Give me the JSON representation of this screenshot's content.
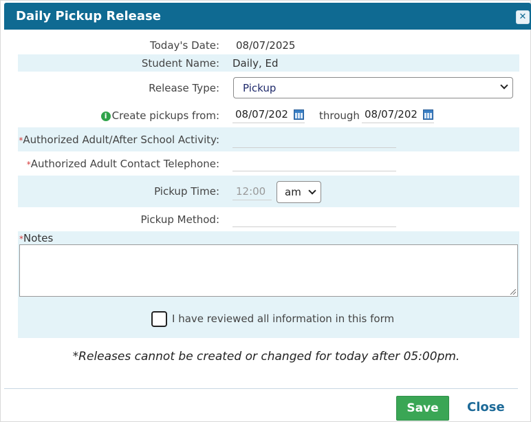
{
  "dialog": {
    "title": "Daily Pickup Release",
    "close_icon": "close-icon"
  },
  "form": {
    "todays_date_label": "Today's Date:",
    "todays_date_value": "08/07/2025",
    "student_name_label": "Student Name:",
    "student_name_value": "Daily, Ed",
    "release_type_label": "Release Type:",
    "release_type_value": "Pickup",
    "create_pickups_label": "Create pickups from:",
    "from_date": "08/07/202",
    "through_label": "through",
    "through_date": "08/07/202",
    "authorized_adult_label": "Authorized Adult/After School Activity:",
    "authorized_adult_value": "",
    "contact_phone_label": "Authorized Adult Contact Telephone:",
    "contact_phone_value": "",
    "pickup_time_label": "Pickup Time:",
    "pickup_time_placeholder": "12:00",
    "ampm_value": "am",
    "pickup_method_label": "Pickup Method:",
    "pickup_method_value": "",
    "required_marker": "*",
    "notes_label": "Notes",
    "notes_value": "",
    "review_checkbox_label": "I have reviewed all information in this form",
    "review_checked": false,
    "footnote": "*Releases cannot be created or changed for today after 05:00pm."
  },
  "buttons": {
    "save_label": "Save",
    "close_label": "Close"
  },
  "colors": {
    "header_bg": "#0f6a92",
    "band_bg": "#e4f3f8",
    "save_bg": "#3aa655",
    "close_link": "#1d6a98",
    "required": "#d63b3b"
  }
}
